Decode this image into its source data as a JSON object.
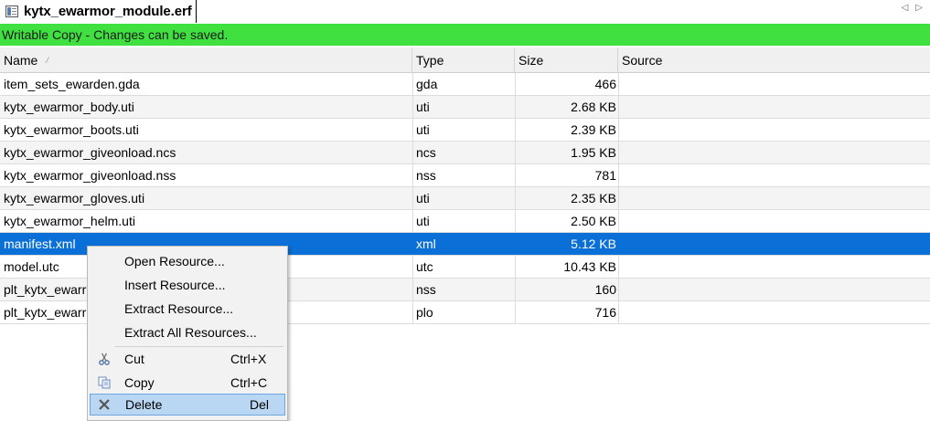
{
  "tab": {
    "title": "kytx_ewarmor_module.erf",
    "nav_left": "◁",
    "nav_right": "▷"
  },
  "status": {
    "text": "Writable Copy - Changes can be saved.",
    "color": "#40e040"
  },
  "columns": {
    "name": "Name",
    "type": "Type",
    "size": "Size",
    "source": "Source"
  },
  "rows": [
    {
      "name": "item_sets_ewarden.gda",
      "type": "gda",
      "size": "466",
      "source": ""
    },
    {
      "name": "kytx_ewarmor_body.uti",
      "type": "uti",
      "size": "2.68 KB",
      "source": ""
    },
    {
      "name": "kytx_ewarmor_boots.uti",
      "type": "uti",
      "size": "2.39 KB",
      "source": ""
    },
    {
      "name": "kytx_ewarmor_giveonload.ncs",
      "type": "ncs",
      "size": "1.95 KB",
      "source": ""
    },
    {
      "name": "kytx_ewarmor_giveonload.nss",
      "type": "nss",
      "size": "781",
      "source": ""
    },
    {
      "name": "kytx_ewarmor_gloves.uti",
      "type": "uti",
      "size": "2.35 KB",
      "source": ""
    },
    {
      "name": "kytx_ewarmor_helm.uti",
      "type": "uti",
      "size": "2.50 KB",
      "source": ""
    },
    {
      "name": "manifest.xml",
      "type": "xml",
      "size": "5.12 KB",
      "source": "",
      "selected": true
    },
    {
      "name": "model.utc",
      "type": "utc",
      "size": "10.43 KB",
      "source": ""
    },
    {
      "name": "plt_kytx_ewarr",
      "type": "nss",
      "size": "160",
      "source": ""
    },
    {
      "name": "plt_kytx_ewarr",
      "type": "plo",
      "size": "716",
      "source": ""
    }
  ],
  "context_menu": {
    "open": "Open Resource...",
    "insert": "Insert Resource...",
    "extract": "Extract Resource...",
    "extract_all": "Extract All Resources...",
    "cut": "Cut",
    "cut_shortcut": "Ctrl+X",
    "copy": "Copy",
    "copy_shortcut": "Ctrl+C",
    "delete": "Delete",
    "delete_shortcut": "Del"
  },
  "colors": {
    "selection": "#0a6fd6",
    "menu_hover": "#b9d6f3",
    "status_bar": "#40e040"
  },
  "icons": {
    "tab": "document-icon",
    "cut": "scissors-icon",
    "copy": "copy-icon",
    "delete": "delete-x-icon"
  }
}
